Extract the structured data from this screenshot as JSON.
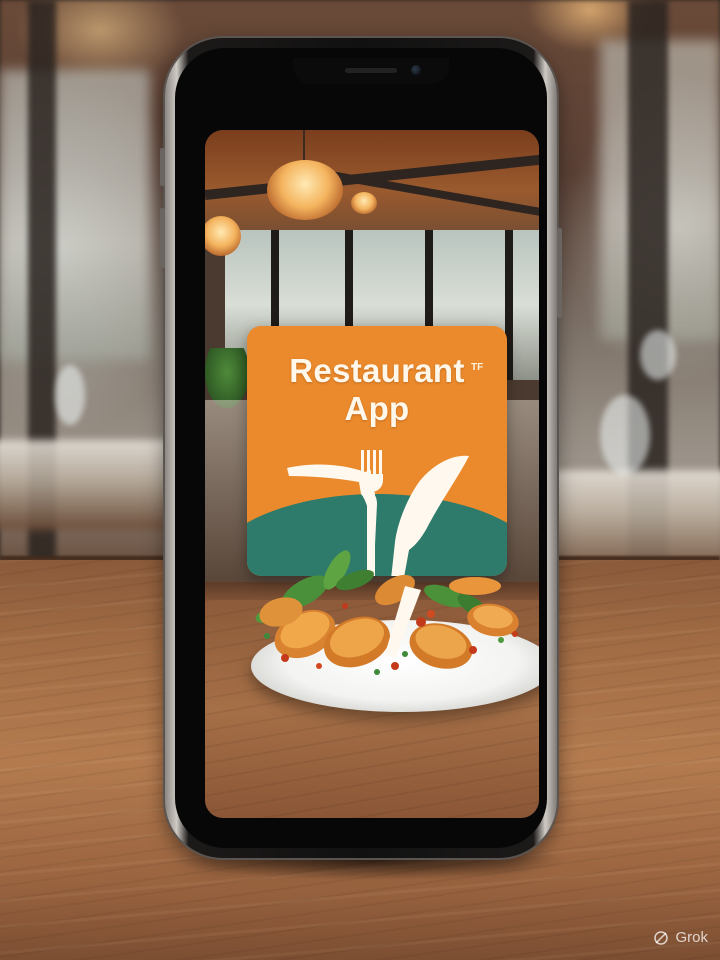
{
  "app_card": {
    "title_line1": "Restaurant",
    "title_line2": "App",
    "title_mark": "TF",
    "colors": {
      "orange": "#ea8a2c",
      "teal": "#2e7a6b",
      "title_text": "#fff7ea"
    }
  },
  "icons": {
    "logo": "fork-and-knife-icon",
    "watermark": "grok-logo-icon"
  },
  "watermark": {
    "label": "Grok"
  }
}
